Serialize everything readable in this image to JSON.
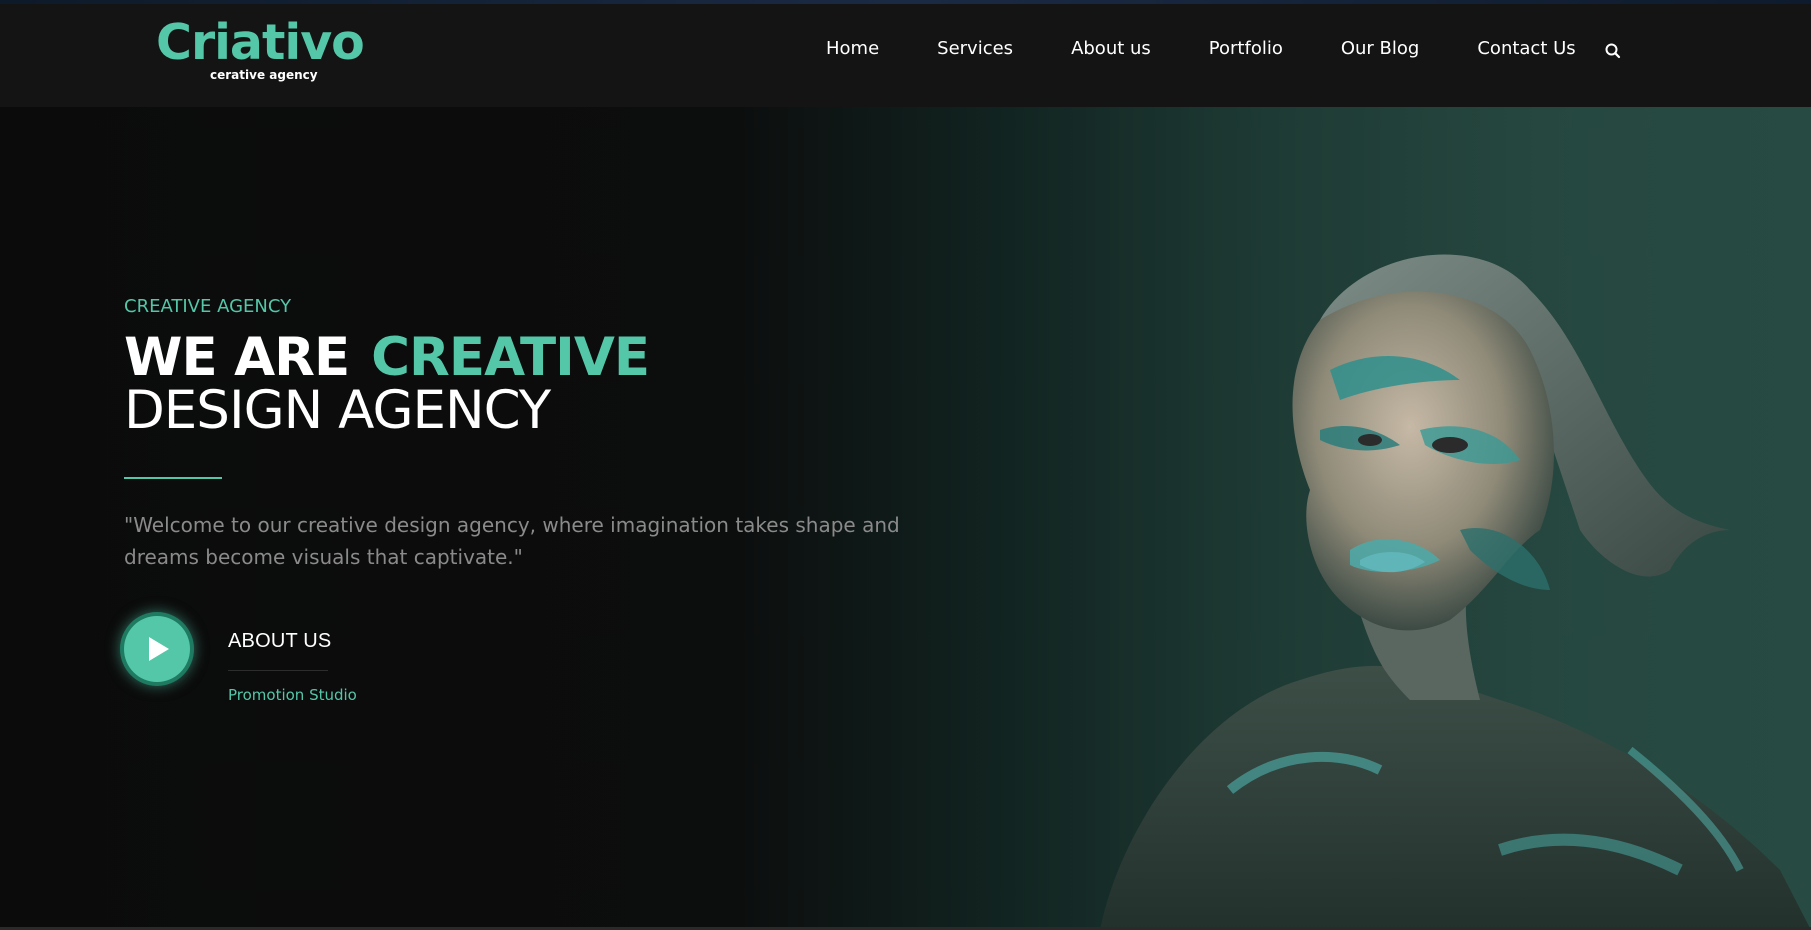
{
  "brand": {
    "name": "Criativo",
    "tagline": "cerative agency",
    "accent_color": "#54c7a8"
  },
  "nav": {
    "items": [
      {
        "label": "Home"
      },
      {
        "label": "Services"
      },
      {
        "label": "About us"
      },
      {
        "label": "Portfolio"
      },
      {
        "label": "Our Blog"
      },
      {
        "label": "Contact Us"
      }
    ],
    "search_icon": "search-icon"
  },
  "hero": {
    "eyebrow": "CREATIVE AGENCY",
    "headline_part1": "WE ARE",
    "headline_accent": "CREATIVE",
    "headline_line2": "DESIGN AGENCY",
    "intro": "\"Welcome to our creative design agency, where imagination takes shape and dreams become visuals that captivate.\""
  },
  "cta": {
    "title": "ABOUT US",
    "subtitle": "Promotion Studio",
    "play_icon": "play-icon"
  },
  "portrait": {
    "description_icon": "face-paint-portrait"
  }
}
